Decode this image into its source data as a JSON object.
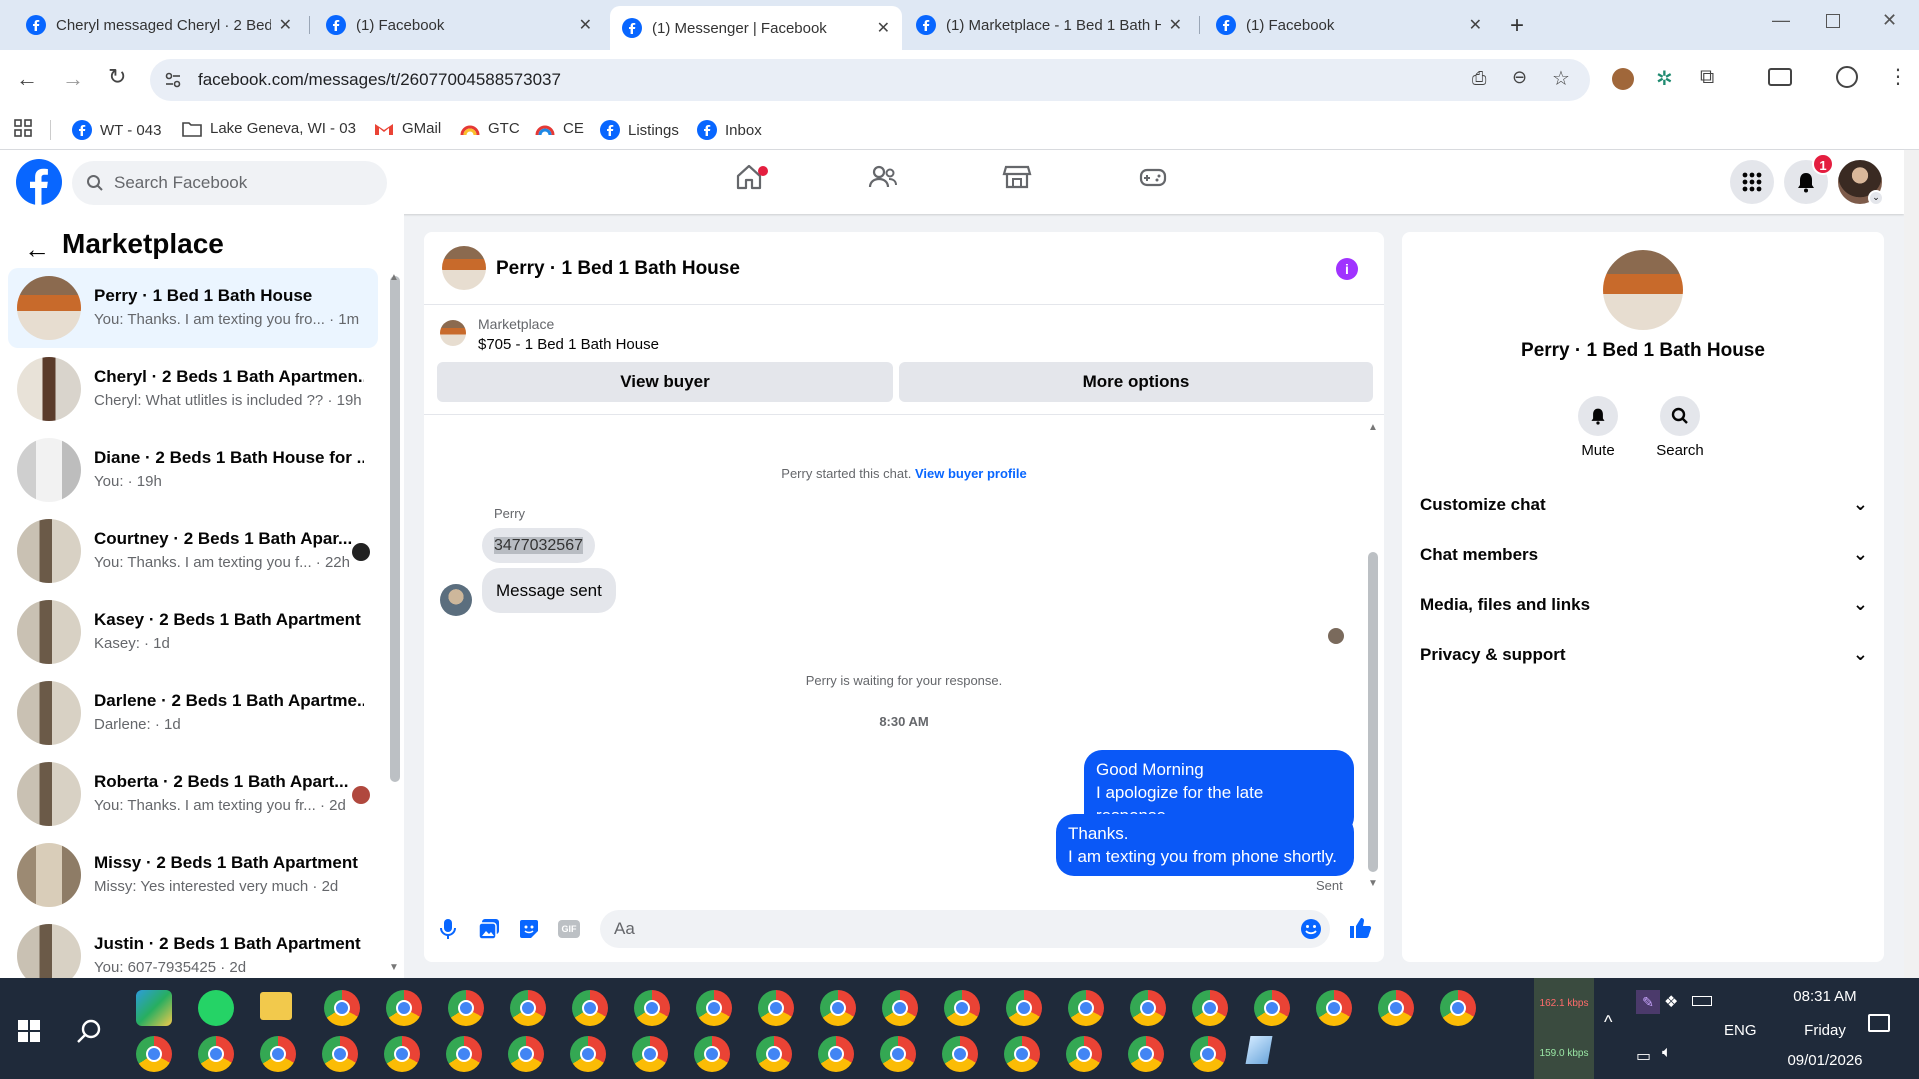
{
  "browser": {
    "tabs": [
      {
        "title": "Cheryl messaged Cheryl · 2 Bed"
      },
      {
        "title": "(1) Facebook"
      },
      {
        "title": "(1) Messenger | Facebook"
      },
      {
        "title": "(1) Marketplace - 1 Bed 1 Bath H"
      },
      {
        "title": "(1) Facebook"
      }
    ],
    "url": "facebook.com/messages/t/26077004588573037",
    "bookmarks": [
      {
        "label": "WT - 043"
      },
      {
        "label": "Lake Geneva, WI - 03"
      },
      {
        "label": "GMail"
      },
      {
        "label": "GTC"
      },
      {
        "label": "CE"
      },
      {
        "label": "Listings"
      },
      {
        "label": "Inbox"
      }
    ]
  },
  "fb_header": {
    "search_placeholder": "Search Facebook",
    "notification_count": "1"
  },
  "sidebar": {
    "title": "Marketplace",
    "conversations": [
      {
        "name": "Perry · 1 Bed 1 Bath House",
        "preview": "You: Thanks. I am texting you fro... · 1m"
      },
      {
        "name": "Cheryl · 2 Beds 1 Bath Apartmen...",
        "preview": "Cheryl: What utlitles is included ?? · 19h"
      },
      {
        "name": "Diane · 2 Beds 1 Bath House for ...",
        "preview": "You: · 19h"
      },
      {
        "name": "Courtney · 2 Beds 1 Bath Apar...",
        "preview": "You: Thanks. I am texting you f... · 22h"
      },
      {
        "name": "Kasey · 2 Beds 1 Bath Apartment",
        "preview": "Kasey: · 1d"
      },
      {
        "name": "Darlene · 2 Beds 1 Bath Apartme...",
        "preview": "Darlene: · 1d"
      },
      {
        "name": "Roberta · 2 Beds 1 Bath Apart...",
        "preview": "You: Thanks. I am texting you fr... · 2d"
      },
      {
        "name": "Missy · 2 Beds 1 Bath Apartment",
        "preview": "Missy: Yes interested very much · 2d"
      },
      {
        "name": "Justin · 2 Beds 1 Bath Apartment",
        "preview": "You: 607-7935425 · 2d"
      }
    ]
  },
  "chat": {
    "title": "Perry · 1 Bed 1 Bath House",
    "listing_label": "Marketplace",
    "listing_price": "$705 - 1 Bed 1 Bath House",
    "view_buyer": "View buyer",
    "more_options": "More options",
    "started_text": "Perry started this chat.",
    "view_buyer_profile": "View buyer profile",
    "sender_name": "Perry",
    "msg_phone": "3477032567",
    "msg_sent": "Message sent",
    "waiting_text": "Perry is waiting for your response.",
    "time": "8:30 AM",
    "out1_line1": "Good Morning",
    "out1_line2": "I apologize for the late response.",
    "out2_line1": "Thanks.",
    "out2_line2": "I am texting you from phone shortly.",
    "sent_label": "Sent",
    "composer_placeholder": "Aa"
  },
  "info_panel": {
    "title": "Perry · 1 Bed 1 Bath House",
    "mute": "Mute",
    "search": "Search",
    "sections": [
      "Customize chat",
      "Chat members",
      "Media, files and links",
      "Privacy & support"
    ]
  },
  "taskbar": {
    "net_up": "162.1 kbps",
    "net_down": "159.0 kbps",
    "lang": "ENG",
    "time": "08:31 AM",
    "day": "Friday",
    "date": "09/01/2026"
  },
  "colors": {
    "fb_blue": "#0866ff",
    "bubble_out": "#0a58f7",
    "accent_purple": "#a033ff"
  }
}
